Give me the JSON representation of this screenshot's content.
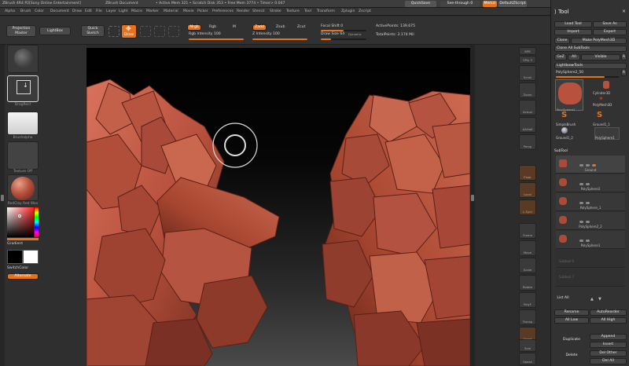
{
  "titlebar": {
    "app": "ZBrush 4R4 P2[Sony Online Entertainment]",
    "doc": "ZBrush Document",
    "stats": "• Active Mem 321 • Scratch Disk 353 • Free Mem 3774 • Timer> 0.047",
    "quicksave": "QuickSave",
    "seethrough": "See-through 0",
    "menus": "Menus",
    "script": "DefaultZScript"
  },
  "menu": [
    "Alpha",
    "Brush",
    "Color",
    "Document",
    "Draw",
    "Edit",
    "File",
    "Layer",
    "Light",
    "Macro",
    "Marker",
    "Material",
    "Movie",
    "Picker",
    "Preferences",
    "Render",
    "Stencil",
    "Stroke",
    "Texture",
    "Tool",
    "Transform",
    "Zplugin",
    "Zscript"
  ],
  "toolbar": {
    "projection": "Projection Master",
    "lightbox": "LightBox",
    "quicksketch": "Quick Sketch",
    "draw": "Draw",
    "mrgb": "Mrgb",
    "rgb": "Rgb",
    "m": "M",
    "rgb_intensity": "Rgb Intensity 100",
    "zadd": "Zadd",
    "zsub": "Zsub",
    "zcut": "Zcut",
    "z_intensity": "Z Intensity 100",
    "focal_shift": "Focal Shift 0",
    "draw_size": "Draw Size 64",
    "dynamic": "Dynamic",
    "active_points": "ActivePoints: 139,675",
    "total_points": "TotalPoints: 3.174 Mil"
  },
  "left": {
    "stroke": "DragRect",
    "alpha": "Brushalpha",
    "texture": "Texture Off",
    "material": "RedClay Red Wax",
    "gradient": "Gradient",
    "switchcolor": "SwitchColor",
    "alternate": "Alternate",
    "colors": {
      "main": "#e8721c",
      "clay": "#b8513d"
    }
  },
  "right_shelf": [
    "BPR",
    "SPix 3",
    "Scroll",
    "Zoom",
    "Actual",
    "AAHalf",
    "Persp",
    "Floor",
    "Local",
    "L.Sym",
    "Frame",
    "Move",
    "Scale",
    "Rotate",
    "PolyF",
    "Transp",
    "Ghost",
    "Solo",
    "Xpose"
  ],
  "tool": {
    "header": "Tool",
    "load": "Load Tool",
    "save": "Save As",
    "import": "Import",
    "export": "Export",
    "clone": "Clone",
    "polymesh": "Make PolyMesh3D",
    "clone_all": "Clone All SubTools",
    "goz": "GoZ",
    "all": "All",
    "visible": "Visible",
    "r": "R",
    "lightbox_tools": "Lightbox▸Tools",
    "current": "PolySphere2_50",
    "items": [
      "PolySphere2",
      "Cylinder3D",
      "PolyMesh3D",
      "SimpleBrush",
      "Ground1_1",
      "Ground1_2",
      "PolySphere1"
    ],
    "subtool_header": "SubTool",
    "subtools": [
      "Ground",
      "PolySphere2",
      "PolySphere_1",
      "PolySphere2_2",
      "PolySphere1",
      "Subtool 6",
      "Subtool 7"
    ],
    "list_all": "List All",
    "rename": "Rename",
    "autoreorder": "AutoReorder",
    "all_low": "All Low",
    "all_high": "All High",
    "duplicate": "Duplicate",
    "append": "Append",
    "insert": "Insert",
    "delete": "Delete",
    "del_other": "Del Other",
    "del_all": "Del All"
  }
}
